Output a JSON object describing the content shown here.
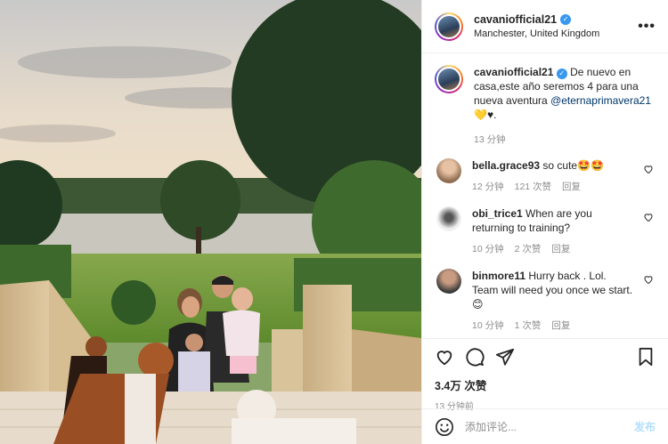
{
  "post": {
    "username": "cavaniofficial21",
    "location": "Manchester, United Kingdom",
    "more_label": "•••"
  },
  "caption": {
    "username": "cavaniofficial21",
    "text": "De nuevo en casa,este año seremos 4 para una nueva aventura ",
    "mention": "@eternaprimavera21",
    "tail": " 💛♥.",
    "time": "13 分钟"
  },
  "comments": [
    {
      "username": "bella.grace93",
      "text": "so cute🤩🤩",
      "time": "12 分钟",
      "likes": "121 次赞",
      "reply": "回复"
    },
    {
      "username": "obi_trice1",
      "text": "When are you returning to training?",
      "time": "10 分钟",
      "likes": "2 次赞",
      "reply": "回复"
    },
    {
      "username": "binmore11",
      "text": "Hurry back . Lol. Team will need you once we start. 😊",
      "time": "10 分钟",
      "likes": "1 次赞",
      "reply": "回复"
    }
  ],
  "stats": {
    "likes": "3.4万 次赞",
    "posted": "13 分钟前"
  },
  "add_comment": {
    "placeholder": "添加评论...",
    "post_label": "发布"
  },
  "icons": [
    "verified-icon",
    "more-icon",
    "heart-icon",
    "comment-icon",
    "share-icon",
    "bookmark-icon",
    "emoji-icon"
  ],
  "colors": {
    "verified": "#3897f0",
    "link": "#00376b",
    "muted": "#8e8e8e",
    "post_button": "#b2dffc"
  }
}
